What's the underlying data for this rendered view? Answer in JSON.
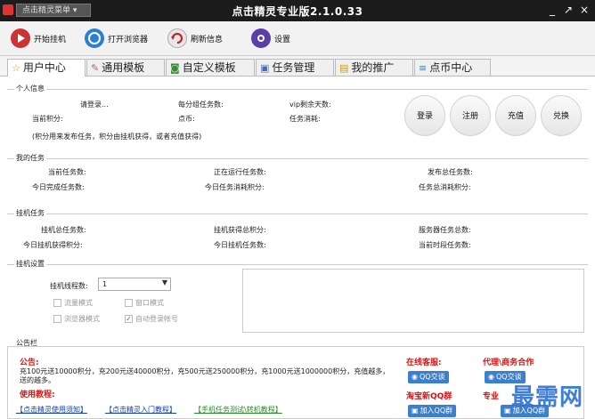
{
  "titlebar": {
    "menu_label": "点击精灵菜单 ▾",
    "title": "点击精灵专业版2.1.0.33",
    "minimize": "_",
    "restore": "↗",
    "close": "×"
  },
  "toolbar": {
    "start": "开始挂机",
    "browser": "打开浏览器",
    "refresh": "刷新信息",
    "settings": "设置"
  },
  "tabs": [
    "用户中心",
    "通用模板",
    "自定义模板",
    "任务管理",
    "我的推广",
    "点币中心"
  ],
  "personal": {
    "label": "个人信息",
    "login_prompt": "请登录...",
    "tasks_per_group": "每分组任务数:",
    "vip_days": "vip剩余天数:",
    "current_points": "当前积分:",
    "coins": "点币:",
    "task_consumption": "任务消耗:",
    "note": "(积分用来发布任务，积分由挂机获得，或者充值获得)",
    "buttons": [
      "登录",
      "注册",
      "充值",
      "兑换"
    ]
  },
  "my_tasks": {
    "label": "我的任务",
    "current": "当前任务数:",
    "running": "正在运行任务数:",
    "published_total": "发布总任务数:",
    "today_completed": "今日完成任务数:",
    "today_points": "今日任务消耗积分:",
    "total_points": "任务总消耗积分:"
  },
  "hang_tasks": {
    "label": "挂机任务",
    "total": "挂机总任务数:",
    "total_points": "挂机获得总积分:",
    "server_total": "服务器任务总数:",
    "today_points": "今日挂机获得积分:",
    "today_tasks": "今日挂机任务数:",
    "current_period": "当前时段任务数:"
  },
  "hang_settings": {
    "label": "挂机设置",
    "threads_label": "挂机线程数:",
    "threads_value": "1",
    "traffic_mode": "流量模式",
    "window_mode": "窗口模式",
    "browser_mode": "浏览器模式",
    "auto_login": "自动登录帐号"
  },
  "announcement": {
    "label": "公告栏",
    "heading": "公告:",
    "body": "充100元送10000积分，充200元送40000积分，充500元送250000积分，充1000元送1000000积分，充值越多，送的越多。",
    "tutorial_heading": "使用教程:",
    "links": [
      "【点击精灵使用须知】",
      "【点击精灵入门教程】",
      "【手机任务测试\\转机教程】"
    ],
    "online_service": "在线客服:",
    "agent": "代理\\商务合作",
    "qq_chat": "QQ交谈",
    "taobao_group": "淘宝新QQ群",
    "pro_group": "专业",
    "join_qq": "加入QQ群"
  },
  "watermark": "最需网",
  "colors": {
    "accent_red": "#d11111",
    "link_blue": "#1141b8",
    "qq_blue": "#3b7fd1"
  }
}
